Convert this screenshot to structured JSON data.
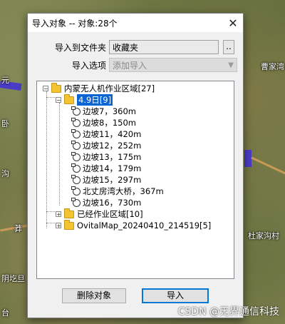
{
  "dialog": {
    "title": "导入对象 -- 对象:28个",
    "close_glyph": "✕",
    "folder_label": "导入到文件夹",
    "folder_value": "收藏夹",
    "browse_label": "..",
    "option_label": "导入选项",
    "option_value": "添加导入",
    "delete_button": "删除对象",
    "import_button": "导入"
  },
  "tree": {
    "root": {
      "label": "内蒙无人机作业区域[27]",
      "expander": "−"
    },
    "date_folder": {
      "label": "4.9日[9]",
      "expander": "−"
    },
    "items": [
      "边坡7，360m",
      "边坡8，150m",
      "边坡11，420m",
      "边坡12，252m",
      "边坡13，175m",
      "边坡14，179m",
      "边坡15，297m",
      "北丈房湾大桥，367m",
      "边坡16，730m"
    ],
    "collapsed": [
      {
        "label": "已经作业区域[10]",
        "expander": "+"
      },
      {
        "label": "OvitalMap_20240410_214519[5]",
        "expander": "+"
      }
    ]
  },
  "map_labels": {
    "l1": "元",
    "l2": "曹家湾",
    "l3": "卧",
    "l4": "沟",
    "l5": "莽",
    "l6": "杜家沟村",
    "l7": "阴圪旦",
    "l8": "台"
  },
  "watermark": "CSDN @无界通信科技"
}
